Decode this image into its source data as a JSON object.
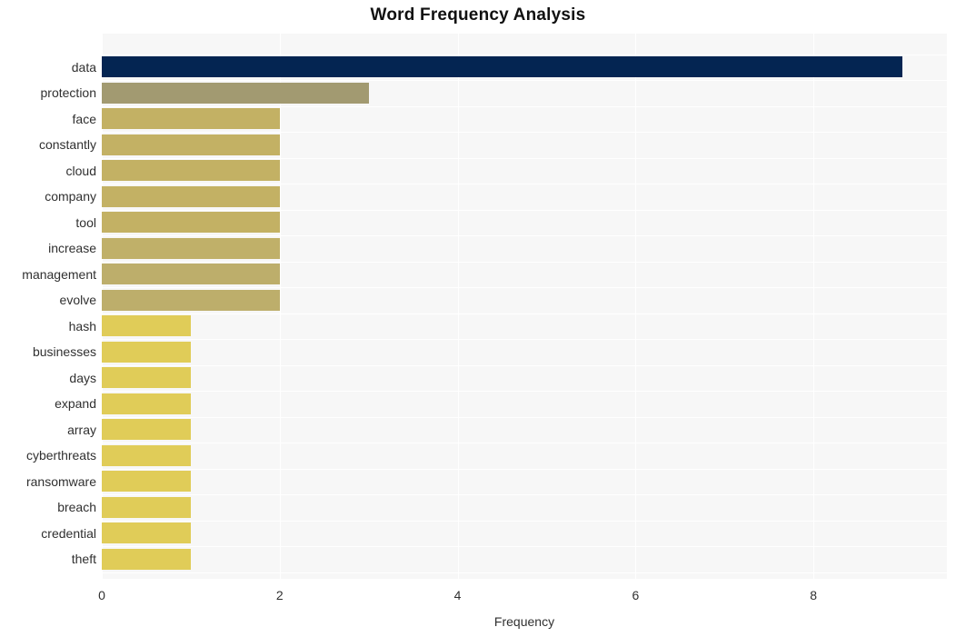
{
  "chart_data": {
    "type": "bar",
    "orientation": "horizontal",
    "title": "Word Frequency Analysis",
    "xlabel": "Frequency",
    "ylabel": "",
    "xlim": [
      0,
      9.5
    ],
    "xticks": [
      "0",
      "2",
      "4",
      "6",
      "8"
    ],
    "xtick_values": [
      0,
      2,
      4,
      6,
      8
    ],
    "grid": true,
    "legend": "none",
    "plot_background": "#f7f7f7",
    "gridline_color": "#ffffff",
    "categories": [
      "data",
      "protection",
      "face",
      "constantly",
      "cloud",
      "company",
      "tool",
      "increase",
      "management",
      "evolve",
      "hash",
      "businesses",
      "days",
      "expand",
      "array",
      "cyberthreats",
      "ransomware",
      "breach",
      "credential",
      "theft"
    ],
    "values": [
      9,
      3,
      2,
      2,
      2,
      2,
      2,
      2,
      2,
      2,
      1,
      1,
      1,
      1,
      1,
      1,
      1,
      1,
      1,
      1
    ],
    "bar_colors": [
      "#042552",
      "#a29a71",
      "#c3b164",
      "#c3b164",
      "#c3b164",
      "#c3b164",
      "#c3b164",
      "#c0b069",
      "#bdae6b",
      "#bdae6b",
      "#e0cc58",
      "#e0cc58",
      "#e0cc58",
      "#e0cc58",
      "#e0cc58",
      "#e0cc58",
      "#e0cc58",
      "#e0cc58",
      "#e0cc58",
      "#e0cc58"
    ]
  }
}
